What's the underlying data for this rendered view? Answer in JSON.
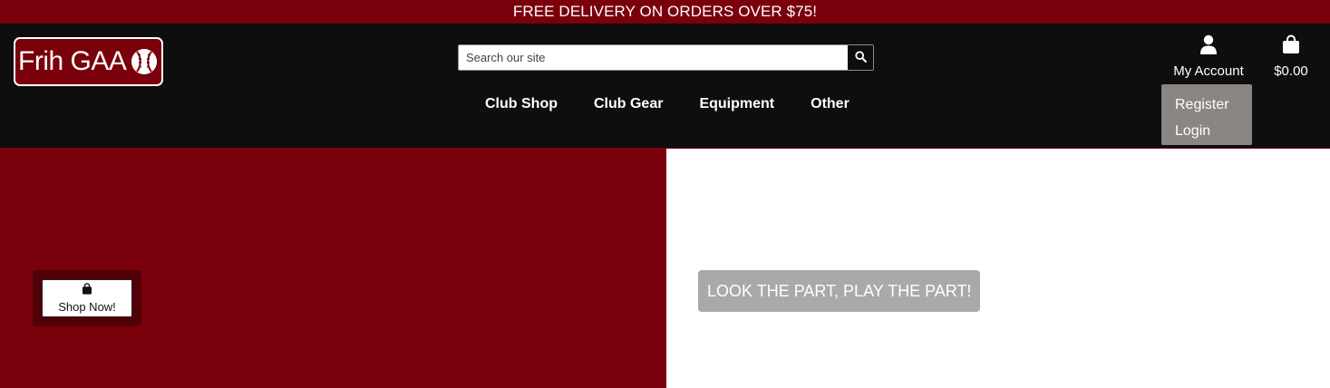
{
  "banner": {
    "text": "FREE DELIVERY ON ORDERS OVER $75!"
  },
  "header": {
    "logo_text": "Frih GAA",
    "search": {
      "placeholder": "Search our site",
      "button_icon": "search-icon"
    },
    "nav": [
      {
        "label": "Club Shop"
      },
      {
        "label": "Club Gear"
      },
      {
        "label": "Equipment"
      },
      {
        "label": "Other"
      }
    ],
    "account": {
      "label": "My Account",
      "icon": "user-icon"
    },
    "cart": {
      "label": "$0.00",
      "icon": "shopping-bag-icon"
    },
    "account_menu": [
      {
        "label": "Register"
      },
      {
        "label": "Login"
      }
    ]
  },
  "hero": {
    "shop_button_label": "Shop Now!",
    "tagline": "LOOK THE PART, PLAY THE PART!"
  },
  "colors": {
    "brand": "#7a000b",
    "header_bg": "#0e0e0e",
    "dropdown_bg": "#8a8683",
    "tagline_bg": "#a9a9a9"
  }
}
